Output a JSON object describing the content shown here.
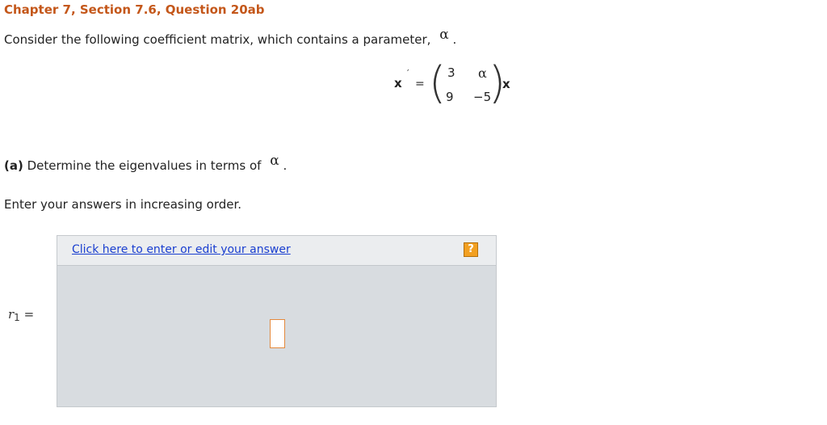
{
  "title": "Chapter 7, Section 7.6, Question 20ab",
  "intro": {
    "text": "Consider the following coefficient matrix, which contains a parameter,",
    "symbol": "α",
    "end": "."
  },
  "equation": {
    "lhs": "x",
    "prime": "′",
    "equals": "=",
    "left_paren": "(",
    "right_paren": ")",
    "matrix": [
      [
        "3",
        "α"
      ],
      [
        "9",
        "−5"
      ]
    ],
    "rhs": "x"
  },
  "part_a": {
    "label": "(a)",
    "text": "Determine the eigenvalues in terms of",
    "symbol": "α",
    "end": "."
  },
  "instruction": "Enter your answers in increasing order.",
  "answer_panel": {
    "edit_link": "Click here to enter or edit your answer",
    "help_icon": "question-icon",
    "help_glyph": "?",
    "accent_color": "#f2a021"
  },
  "r1_label": {
    "var": "r",
    "sub": "1",
    "eq": "="
  }
}
